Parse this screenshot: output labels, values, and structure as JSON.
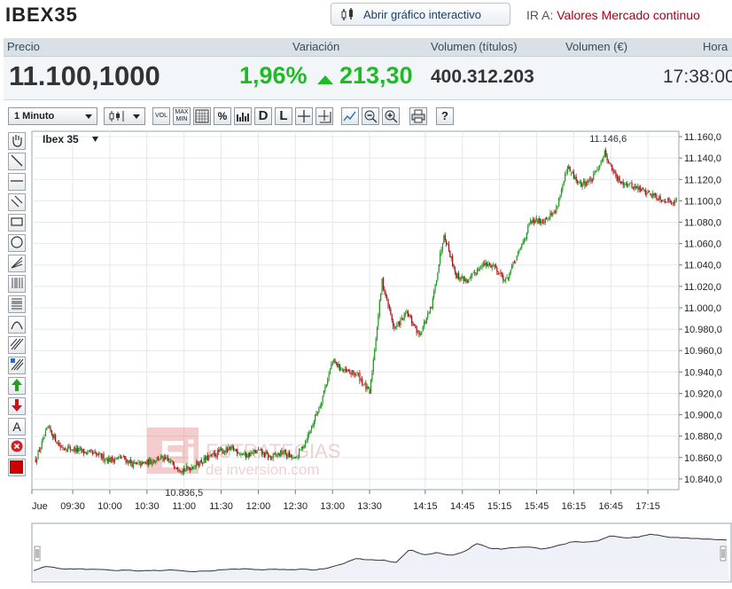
{
  "header": {
    "title": "IBEX35",
    "chart_button_label": "Abrir gráfico interactivo",
    "goto_label": "IR A:",
    "goto_link": "Valores Mercado continuo"
  },
  "quote": {
    "labels": {
      "price": "Precio",
      "change": "Variación",
      "volume_shares": "Volumen (títulos)",
      "volume_eur": "Volumen (€)",
      "time": "Hora"
    },
    "price": "11.100,1000",
    "change_pct": "1,96%",
    "change_points": "213,30",
    "volume_shares": "400.312.203",
    "time": "17:38:00"
  },
  "toolbar": {
    "interval": "1 Minuto",
    "vol_label": "VOL",
    "maxmin_label": "MAX MIN",
    "pct_label": "%",
    "d_label": "D",
    "l_label": "L",
    "help_label": "?"
  },
  "sidebar": {
    "text_tool_label": "A"
  },
  "watermark": {
    "line1": "ESTRATEGIAS",
    "line2": "de inversion.com"
  },
  "colors": {
    "up": "#1fbb24",
    "candle_up": "#1e9a1e",
    "candle_down": "#a01010",
    "accent_red": "#a8001a"
  },
  "chart_data": {
    "type": "candlestick",
    "title": "Ibex 35",
    "instrument": "Ibex 35",
    "x_ticks": [
      "Jue",
      "09:30",
      "10:00",
      "10:30",
      "11:00",
      "11:30",
      "12:00",
      "12:30",
      "13:00",
      "13:30",
      "14:15",
      "14:45",
      "15:15",
      "15:45",
      "16:15",
      "16:45",
      "17:15"
    ],
    "y_ticks": [
      "10.840,0",
      "10.860,0",
      "10.880,0",
      "10.900,0",
      "10.920,0",
      "10.940,0",
      "10.960,0",
      "10.980,0",
      "11.000,0",
      "11.020,0",
      "11.040,0",
      "11.060,0",
      "11.080,0",
      "11.100,0",
      "11.120,0",
      "11.140,0",
      "11.160,0"
    ],
    "ylim": [
      10830,
      11165
    ],
    "grid": true,
    "annotations": [
      {
        "label": "11.146,6",
        "x": "16:45",
        "y": 11146.6
      },
      {
        "label": "10.836,5",
        "x": "11:00",
        "y": 10836.5
      }
    ],
    "series": [
      {
        "x": [
          "09:00",
          "09:10",
          "09:20",
          "09:30",
          "09:40",
          "09:50",
          "10:00",
          "10:10",
          "10:20",
          "10:30",
          "10:40",
          "10:50",
          "11:00",
          "11:10",
          "11:20",
          "11:30",
          "11:40",
          "11:50",
          "12:00",
          "12:10",
          "12:20",
          "12:30",
          "12:40",
          "12:50",
          "13:00",
          "13:10",
          "13:20",
          "13:30",
          "13:40",
          "13:50",
          "14:00",
          "14:10",
          "14:20",
          "14:30",
          "14:40",
          "14:50",
          "15:00",
          "15:10",
          "15:20",
          "15:30",
          "15:40",
          "15:50",
          "16:00",
          "16:10",
          "16:20",
          "16:30",
          "16:40",
          "16:50",
          "17:00",
          "17:10",
          "17:20",
          "17:30"
        ],
        "y": [
          10858,
          10888,
          10870,
          10868,
          10865,
          10862,
          10858,
          10860,
          10853,
          10855,
          10860,
          10855,
          10848,
          10854,
          10860,
          10866,
          10868,
          10862,
          10866,
          10860,
          10865,
          10858,
          10880,
          10910,
          10950,
          10940,
          10938,
          10920,
          11025,
          10980,
          10995,
          10975,
          11000,
          11070,
          11030,
          11025,
          11040,
          11040,
          11025,
          11050,
          11080,
          11082,
          11090,
          11130,
          11115,
          11120,
          11145,
          11120,
          11115,
          11110,
          11105,
          11100
        ]
      }
    ]
  }
}
